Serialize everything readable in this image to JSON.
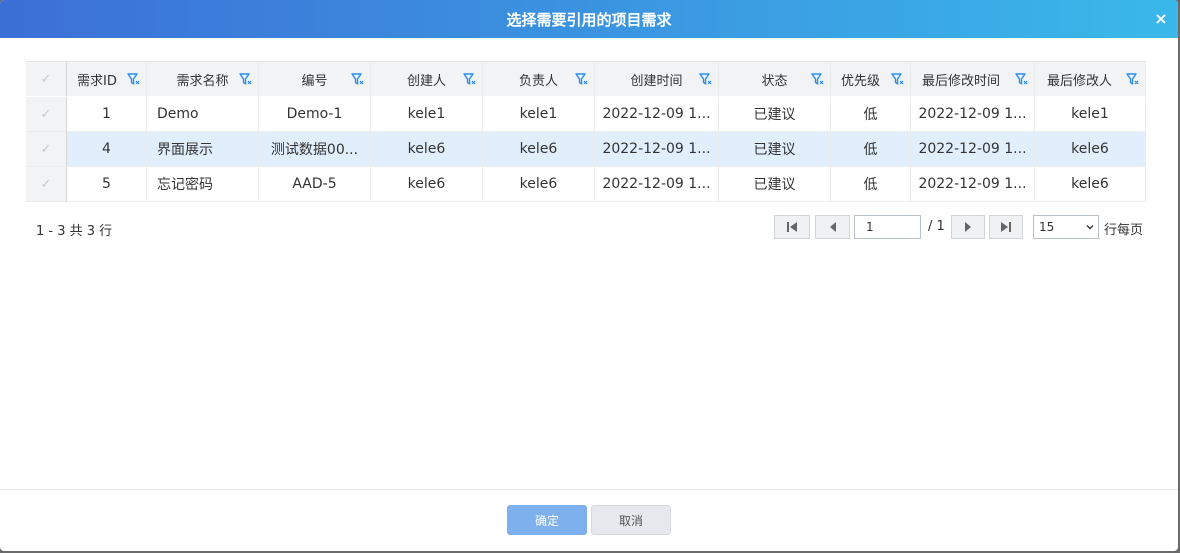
{
  "dialog": {
    "title": "选择需要引用的项目需求",
    "close_label": "×"
  },
  "table": {
    "columns": [
      "需求ID",
      "需求名称",
      "编号",
      "创建人",
      "负责人",
      "创建时间",
      "状态",
      "优先级",
      "最后修改时间",
      "最后修改人"
    ],
    "rows": [
      [
        "1",
        "Demo",
        "Demo-1",
        "kele1",
        "kele1",
        "2022-12-09 1...",
        "已建议",
        "低",
        "2022-12-09 1...",
        "kele1"
      ],
      [
        "4",
        "界面展示",
        "测试数据00...",
        "kele6",
        "kele6",
        "2022-12-09 1...",
        "已建议",
        "低",
        "2022-12-09 1...",
        "kele6"
      ],
      [
        "5",
        "忘记密码",
        "AAD-5",
        "kele6",
        "kele6",
        "2022-12-09 1...",
        "已建议",
        "低",
        "2022-12-09 1...",
        "kele6"
      ]
    ],
    "check_glyph": "✓",
    "filter_color": "#2a8ff0",
    "selected_row_color": "#e1effc"
  },
  "pager": {
    "info": "1 - 3 共 3 行",
    "page_value": "1",
    "total": "/ 1",
    "page_size": "15",
    "per_page_label": "行每页"
  },
  "footer": {
    "ok_label": "确定",
    "cancel_label": "取消"
  }
}
